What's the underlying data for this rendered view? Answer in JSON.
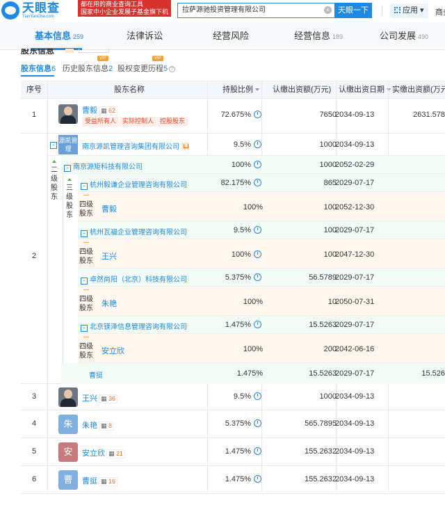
{
  "brand": {
    "name": "天眼查",
    "url_text": "TianYanCha.com",
    "slogan_line1": "都在用的商业查询工具",
    "slogan_line2": "国家中小企业发展子基金旗下机构"
  },
  "search": {
    "value": "拉萨源驰投资管理有限公司",
    "button": "天眼一下",
    "clear": "×"
  },
  "header": {
    "apps_label": "应用",
    "more_label": "商务"
  },
  "tabs": [
    {
      "label": "基本信息",
      "count": "259"
    },
    {
      "label": "法律诉讼",
      "count": ""
    },
    {
      "label": "经营风险",
      "count": ""
    },
    {
      "label": "经营信息",
      "count": "189"
    },
    {
      "label": "公司发展",
      "count": "490"
    }
  ],
  "section": {
    "title": "股东信息"
  },
  "subtabs": [
    {
      "label": "股东信息",
      "count": "6",
      "vip": ""
    },
    {
      "label": "历史股东信息",
      "count": "2",
      "vip": "VIP"
    },
    {
      "label": "股权变更历程",
      "count": "5",
      "vip": "VIP"
    }
  ],
  "columns": {
    "seq": "序号",
    "name": "股东名称",
    "ratio": "持股比例",
    "subscribed": "认缴出资额(万元)",
    "date": "认缴出资日期",
    "paid": "实缴出资额(万元)"
  },
  "rows": [
    {
      "seq": "1",
      "name": "曹毅",
      "badge": "62",
      "tags": [
        "受益所有人",
        "实际控制人",
        "控股股东"
      ],
      "ratio": "72.675%",
      "amount": "7650",
      "date": "2034-09-13",
      "paid": "2631.578"
    },
    {
      "seq": "3",
      "name": "王兴",
      "badge": "36",
      "ratio": "9.5%",
      "amount": "1000",
      "date": "2034-09-13"
    },
    {
      "seq": "4",
      "name": "朱艳",
      "avatar_char": "朱",
      "badge": "8",
      "ratio": "5.375%",
      "amount": "565.7895",
      "date": "2034-09-13"
    },
    {
      "seq": "5",
      "name": "安立欣",
      "avatar_char": "安",
      "badge": "21",
      "ratio": "1.475%",
      "amount": "155.2632",
      "date": "2034-09-13"
    },
    {
      "seq": "6",
      "name": "曹挺",
      "avatar_char": "曹",
      "badge": "16",
      "ratio": "1.475%",
      "amount": "155.2632",
      "date": "2034-09-13"
    }
  ],
  "group2": {
    "seq": "2",
    "holder": {
      "name": "南京源凯管理咨询集团有限公司",
      "logo": "源凯管理",
      "ratio": "9.5%",
      "amount": "1000",
      "date": "2034-09-13"
    },
    "level2_label": "二级股东",
    "level3_label": "三级股东",
    "level4_label": "四级股东",
    "sub": [
      {
        "name": "南京源矩科技有限公司",
        "ratio": "100%",
        "amount": "1000",
        "date": "2052-02-29"
      },
      {
        "name": "杭州毅谦企业管理咨询有限公司",
        "ratio": "82.175%",
        "amount": "865",
        "date": "2029-07-17"
      },
      {
        "name": "曹毅",
        "ratio": "100%",
        "amount": "100",
        "date": "2052-12-30"
      },
      {
        "name": "杭州瓦福企业管理咨询有限公司",
        "ratio": "9.5%",
        "amount": "100",
        "date": "2029-07-17"
      },
      {
        "name": "王兴",
        "ratio": "100%",
        "amount": "100",
        "date": "2047-12-30"
      },
      {
        "name": "卓然尚阳（北京）科技有限公司",
        "ratio": "5.375%",
        "amount": "56.5789",
        "date": "2029-07-17"
      },
      {
        "name": "朱艳",
        "ratio": "100%",
        "amount": "10",
        "date": "2050-07-31"
      },
      {
        "name": "北京镁泽信息管理咨询有限公司",
        "ratio": "1.475%",
        "amount": "15.5263",
        "date": "2029-07-17"
      },
      {
        "name": "安立欣",
        "ratio": "100%",
        "amount": "200",
        "date": "2042-06-16"
      },
      {
        "name": "曹挺",
        "ratio": "1.475%",
        "amount": "15.5263",
        "date": "2029-07-17",
        "paid": "15.526"
      }
    ]
  },
  "colors": {
    "accent": "#1e88e5",
    "slogan_bg": "#d9322e",
    "header_bg": "#f2f7fe",
    "vip": "#f0a330"
  }
}
